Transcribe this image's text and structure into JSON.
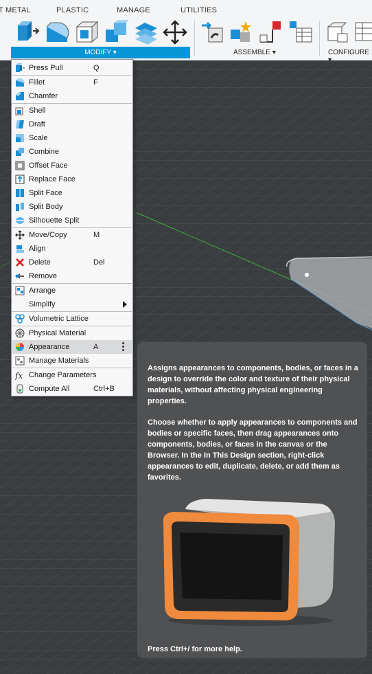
{
  "toolbar": {
    "tabs": [
      "T METAL",
      "PLASTIC",
      "MANAGE",
      "UTILITIES"
    ],
    "groups": {
      "modify": "MODIFY ▾",
      "assemble": "ASSEMBLE ▾",
      "configure": "CONFIGURE ▾"
    }
  },
  "menu": {
    "items": [
      {
        "label": "Press Pull",
        "shortcut": "Q",
        "icon": "press-pull-icon"
      },
      {
        "label": "Fillet",
        "shortcut": "F",
        "icon": "fillet-icon"
      },
      {
        "label": "Chamfer",
        "shortcut": "",
        "icon": "chamfer-icon"
      },
      {
        "label": "Shell",
        "shortcut": "",
        "icon": "shell-icon"
      },
      {
        "label": "Draft",
        "shortcut": "",
        "icon": "draft-icon"
      },
      {
        "label": "Scale",
        "shortcut": "",
        "icon": "scale-icon"
      },
      {
        "label": "Combine",
        "shortcut": "",
        "icon": "combine-icon"
      },
      {
        "label": "Offset Face",
        "shortcut": "",
        "icon": "offset-face-icon"
      },
      {
        "label": "Replace Face",
        "shortcut": "",
        "icon": "replace-face-icon"
      },
      {
        "label": "Split Face",
        "shortcut": "",
        "icon": "split-face-icon"
      },
      {
        "label": "Split Body",
        "shortcut": "",
        "icon": "split-body-icon"
      },
      {
        "label": "Silhouette Split",
        "shortcut": "",
        "icon": "silhouette-split-icon"
      },
      {
        "label": "Move/Copy",
        "shortcut": "M",
        "icon": "move-icon"
      },
      {
        "label": "Align",
        "shortcut": "",
        "icon": "align-icon"
      },
      {
        "label": "Delete",
        "shortcut": "Del",
        "icon": "delete-icon"
      },
      {
        "label": "Remove",
        "shortcut": "",
        "icon": "remove-icon"
      },
      {
        "label": "Arrange",
        "shortcut": "",
        "icon": "arrange-icon"
      },
      {
        "label": "Simplify",
        "shortcut": "",
        "icon": ""
      },
      {
        "label": "Volumetric Lattice",
        "shortcut": "",
        "icon": "volumetric-lattice-icon"
      },
      {
        "label": "Physical Material",
        "shortcut": "",
        "icon": "physical-material-icon"
      },
      {
        "label": "Appearance",
        "shortcut": "A",
        "icon": "appearance-icon"
      },
      {
        "label": "Manage Materials",
        "shortcut": "",
        "icon": "manage-materials-icon"
      },
      {
        "label": "Change Parameters",
        "shortcut": "",
        "icon": "change-parameters-icon"
      },
      {
        "label": "Compute All",
        "shortcut": "Ctrl+B",
        "icon": "compute-all-icon"
      }
    ]
  },
  "tooltip": {
    "para1": "Assigns appearances to components, bodies, or faces in a design to override the color and texture of their physical materials, without affecting physical engineering properties.",
    "para2": "Choose whether to apply appearances to components and bodies or specific faces, then drag appearances onto components, bodies, or faces in the canvas or the Browser. In the In This Design section, right-click appearances to edit, duplicate, delete, or add them as favorites.",
    "help": "Press Ctrl+/ for more help."
  },
  "colors": {
    "accent": "#0696d7",
    "canvas": "#3a3d40",
    "tooltip": "#505153",
    "highlight": "#d9dadc"
  }
}
